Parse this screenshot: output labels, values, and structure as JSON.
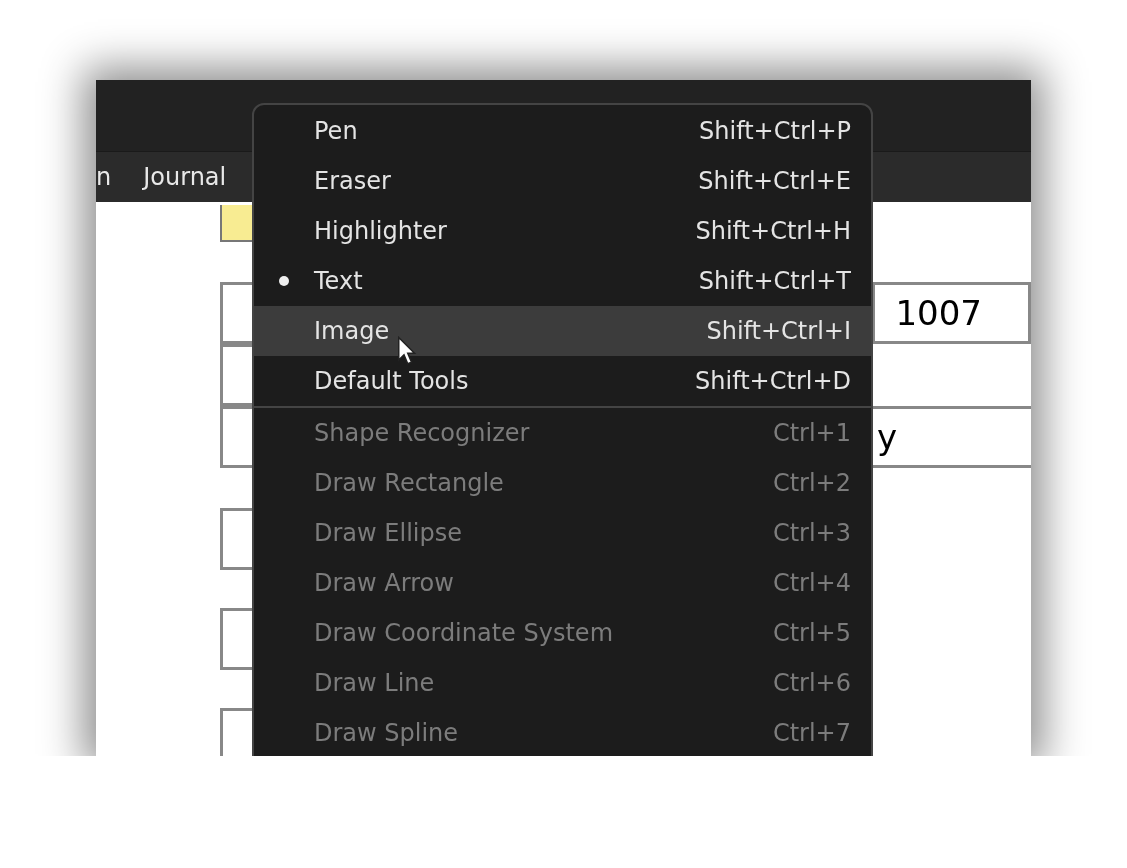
{
  "menubar": [
    {
      "label": "n"
    },
    {
      "label": "Journal"
    }
  ],
  "fields": [
    {
      "value": "1007"
    },
    {
      "value": "y"
    }
  ],
  "menu": {
    "groups": [
      {
        "items": [
          {
            "label": "Pen",
            "shortcut": "Shift+Ctrl+P",
            "selected": false,
            "hovered": false,
            "disabled": false
          },
          {
            "label": "Eraser",
            "shortcut": "Shift+Ctrl+E",
            "selected": false,
            "hovered": false,
            "disabled": false
          },
          {
            "label": "Highlighter",
            "shortcut": "Shift+Ctrl+H",
            "selected": false,
            "hovered": false,
            "disabled": false
          },
          {
            "label": "Text",
            "shortcut": "Shift+Ctrl+T",
            "selected": true,
            "hovered": false,
            "disabled": false
          },
          {
            "label": "Image",
            "shortcut": "Shift+Ctrl+I",
            "selected": false,
            "hovered": true,
            "disabled": false
          },
          {
            "label": "Default Tools",
            "shortcut": "Shift+Ctrl+D",
            "selected": false,
            "hovered": false,
            "disabled": false
          }
        ]
      },
      {
        "items": [
          {
            "label": "Shape Recognizer",
            "shortcut": "Ctrl+1",
            "selected": false,
            "hovered": false,
            "disabled": true
          },
          {
            "label": "Draw Rectangle",
            "shortcut": "Ctrl+2",
            "selected": false,
            "hovered": false,
            "disabled": true
          },
          {
            "label": "Draw Ellipse",
            "shortcut": "Ctrl+3",
            "selected": false,
            "hovered": false,
            "disabled": true
          },
          {
            "label": "Draw Arrow",
            "shortcut": "Ctrl+4",
            "selected": false,
            "hovered": false,
            "disabled": true
          },
          {
            "label": "Draw Coordinate System",
            "shortcut": "Ctrl+5",
            "selected": false,
            "hovered": false,
            "disabled": true
          },
          {
            "label": "Draw Line",
            "shortcut": "Ctrl+6",
            "selected": false,
            "hovered": false,
            "disabled": true
          },
          {
            "label": "Draw Spline",
            "shortcut": "Ctrl+7",
            "selected": false,
            "hovered": false,
            "disabled": true
          }
        ]
      }
    ]
  }
}
